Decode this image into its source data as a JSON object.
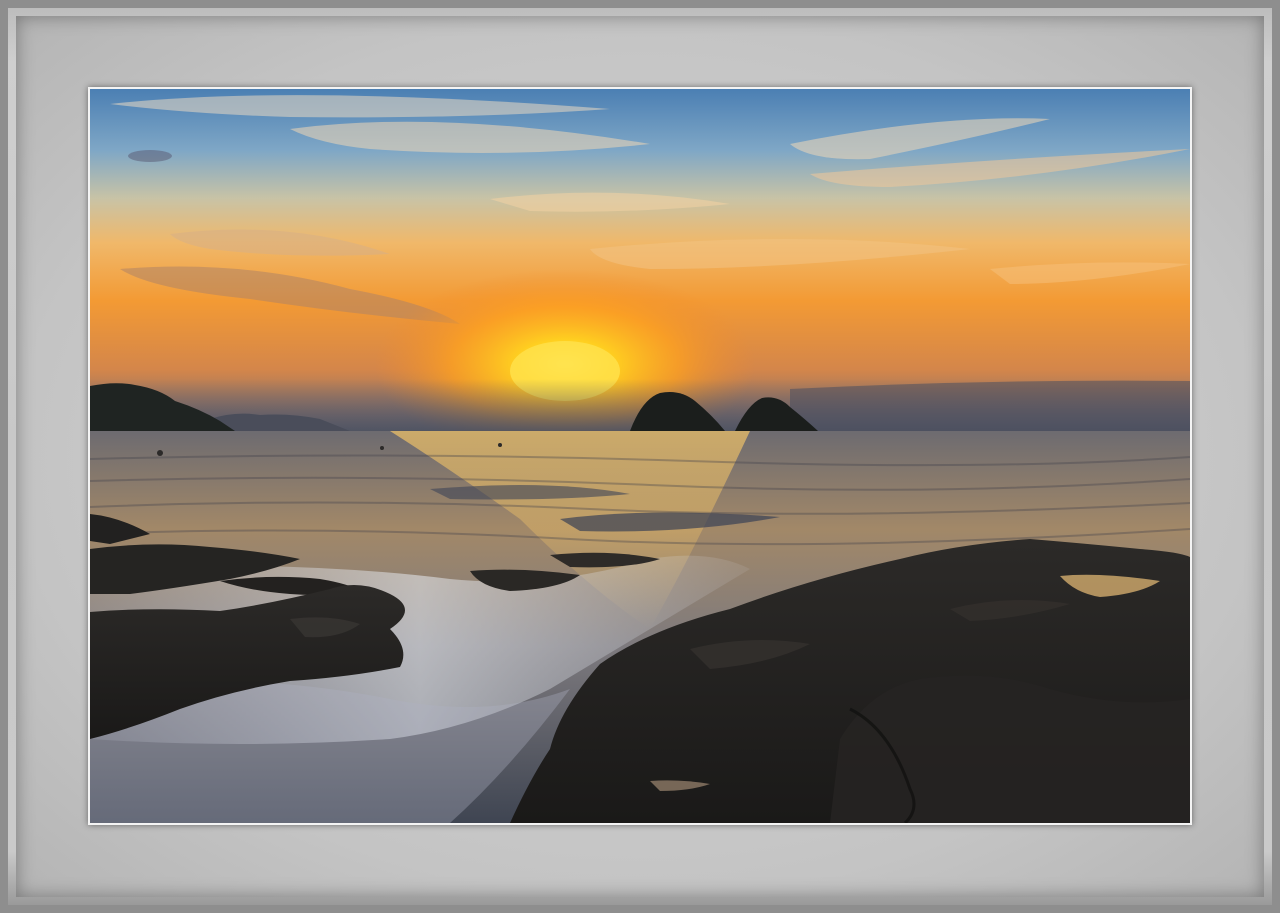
{
  "scene": {
    "subject": "photo",
    "colors": {
      "frame_gray": "#c8c8c8",
      "frame_edge": "#8e8e8e",
      "photo_border": "#f4f4f4",
      "sky_top": "#4f86b8",
      "sky_mid": "#e8b77a",
      "sun_glow": "#ffcc22",
      "horizon_orange": "#f49a2c",
      "sea": "#7b6a55",
      "rock": "#22201e"
    }
  }
}
